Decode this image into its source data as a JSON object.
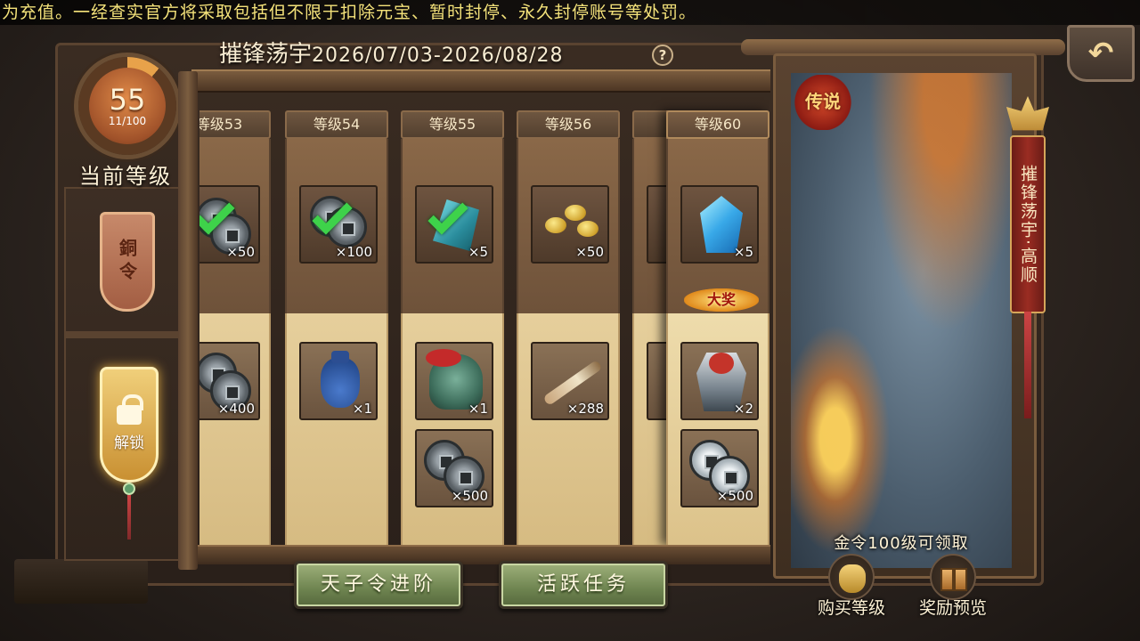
{
  "marquee": "为充值。一经查实官方将采取包括但不限于扣除元宝、暂时封停、永久封停账号等处罚。",
  "header": {
    "title": "摧锋荡宇",
    "date_range": "2026/07/03-2026/08/28",
    "help": "?"
  },
  "level": {
    "current": "55",
    "progress": "11/100",
    "progress_fraction": 0.11,
    "caption": "当前等级"
  },
  "side_tags": {
    "copper": "銅令",
    "unlock": "解锁"
  },
  "columns": [
    {
      "label": "等级53",
      "top": {
        "icon": "copper-coin-icon",
        "qty": "×50",
        "claimed": true
      },
      "bottom": [
        {
          "icon": "copper-coin-icon",
          "qty": "×400"
        }
      ]
    },
    {
      "label": "等级54",
      "top": {
        "icon": "copper-coin-icon",
        "qty": "×100",
        "claimed": true
      },
      "bottom": [
        {
          "icon": "cloth-bag-icon",
          "qty": "×1"
        }
      ]
    },
    {
      "label": "等级55",
      "top": {
        "icon": "jade-stone-icon",
        "qty": "×5",
        "claimed": true
      },
      "bottom": [
        {
          "icon": "general-helmet-icon",
          "qty": "×1"
        },
        {
          "icon": "copper-coin-icon",
          "qty": "×500"
        }
      ]
    },
    {
      "label": "等级56",
      "top": {
        "icon": "gold-beans-icon",
        "qty": "×50",
        "claimed": false
      },
      "bottom": [
        {
          "icon": "feather-brush-icon",
          "qty": "×288"
        }
      ]
    }
  ],
  "featured_column": {
    "label": "等级60",
    "grand_prize": "大奖",
    "top": {
      "icon": "blue-crystal-icon",
      "qty": "×5"
    },
    "bottom": [
      {
        "icon": "armor-icon",
        "qty": "×2"
      },
      {
        "icon": "silver-coin-icon",
        "qty": "×500"
      }
    ]
  },
  "hero_panel": {
    "badge": "传说",
    "banner": "摧锋荡宇·高顺",
    "note": "金令100级可领取"
  },
  "buttons": {
    "advance": "天子令进阶",
    "tasks": "活跃任务",
    "buy_level": "购买等级",
    "reward_preview": "奖励预览",
    "back": "↶"
  }
}
